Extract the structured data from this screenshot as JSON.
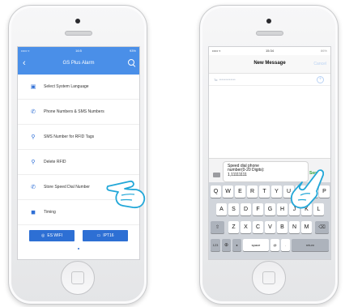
{
  "left_phone": {
    "status": {
      "signal": "••••• ≈",
      "time": "16:5",
      "battery": "93%"
    },
    "header": {
      "back_icon": "chevron-left-icon",
      "title": "GS Plus Alarm",
      "search_icon": "search-icon"
    },
    "menu": [
      {
        "icon": "language-icon",
        "glyph": "▣",
        "label": "Select System Language"
      },
      {
        "icon": "phone-icon",
        "glyph": "✆",
        "label": "Phone Numbers & SMS Numbers"
      },
      {
        "icon": "rfid-icon",
        "glyph": "⚲",
        "label": "SMS Number for RFID Tags"
      },
      {
        "icon": "delete-rfid-icon",
        "glyph": "⚲",
        "label": "Delete RFID"
      },
      {
        "icon": "phone-icon",
        "glyph": "✆",
        "label": "Store Speed Dial Number"
      },
      {
        "icon": "timer-icon",
        "glyph": "◼",
        "label": "Timing"
      }
    ],
    "footer": {
      "button_1": {
        "icon": "wifi-icon",
        "glyph": "◎",
        "label": "ES WIFI"
      },
      "button_2": {
        "icon": "camera-icon",
        "glyph": "▭",
        "label": "IPT16"
      }
    }
  },
  "right_phone": {
    "status": {
      "signal": "••••• ≈",
      "time": "15:34",
      "battery": "86%"
    },
    "nav": {
      "title": "New Message",
      "cancel": "Cancel"
    },
    "to": {
      "label": "To: *************"
    },
    "compose": {
      "text": "Speed dial phone\nnumber(0-20 Digits):\n1,11111111",
      "send": "Send"
    },
    "keyboard": {
      "row1": [
        "Q",
        "W",
        "E",
        "R",
        "T",
        "Y",
        "U",
        "I",
        "O",
        "P"
      ],
      "row2": [
        "A",
        "S",
        "D",
        "F",
        "G",
        "H",
        "J",
        "K",
        "L"
      ],
      "row3": [
        "Z",
        "X",
        "C",
        "V",
        "B",
        "N",
        "M"
      ],
      "row4": {
        "num": "123",
        "globe": "⊕",
        "mic": "🎤",
        "space": "space",
        "at": "@",
        "dot": ".",
        "return": "return"
      }
    }
  },
  "colors": {
    "header_blue": "#4a8fe8",
    "button_blue": "#2d6fd4",
    "send_green": "#2fa33e",
    "hand_outline": "#22a7d8"
  }
}
